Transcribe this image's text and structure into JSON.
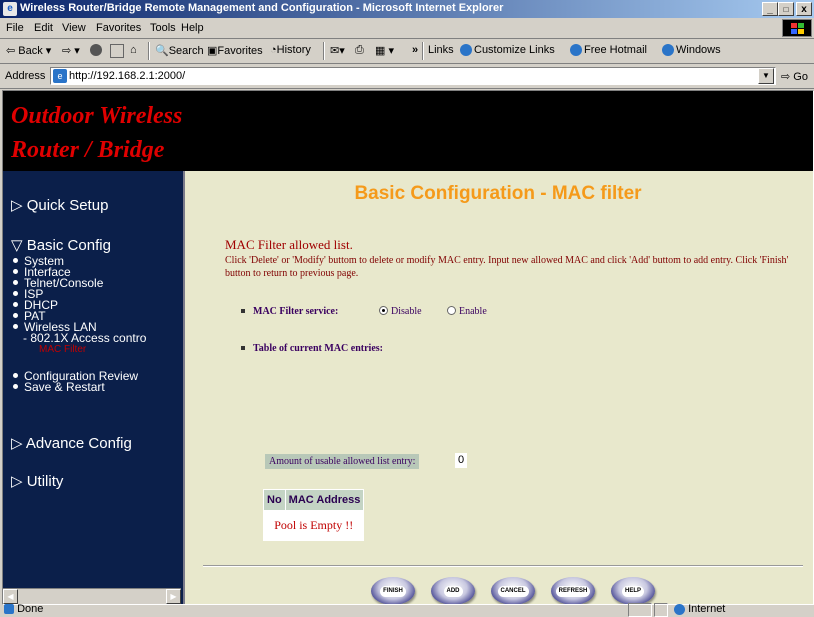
{
  "window": {
    "title": "Wireless Router/Bridge Remote Management and Configuration - Microsoft Internet Explorer",
    "buttons": [
      "_",
      "□",
      "x"
    ]
  },
  "menu": [
    "File",
    "Edit",
    "View",
    "Favorites",
    "Tools",
    "Help"
  ],
  "toolbar": {
    "back": "Back",
    "search": "Search",
    "favorites": "Favorites",
    "history": "History",
    "chevron": "»",
    "links": "Links",
    "link_items": [
      "Customize Links",
      "Free Hotmail",
      "Windows"
    ]
  },
  "address": {
    "label": "Address",
    "url": "http://192.168.2.1:2000/",
    "go": "Go"
  },
  "banner": {
    "line1": "Outdoor Wireless",
    "line2": "Router / Bridge"
  },
  "sidebar": {
    "quick_setup": "Quick Setup",
    "basic_config": "Basic Config",
    "basic_items": [
      "System",
      "Interface",
      "Telnet/Console",
      "ISP",
      "DHCP",
      "PAT",
      "Wireless LAN"
    ],
    "sub_item": "- 802.1X Access contro",
    "sub_item_active": "MAC Filter",
    "review_items": [
      "Configuration Review",
      "Save & Restart"
    ],
    "advance_config": "Advance Config",
    "utility": "Utility"
  },
  "main": {
    "page_title": "Basic Configuration - MAC filter",
    "section_title": "MAC Filter allowed list.",
    "description": "Click 'Delete' or 'Modify' buttom to delete or modify MAC entry. Input new allowed MAC and click 'Add' buttom to add entry. Click 'Finish' button to return to previous page.",
    "service_label": "MAC Filter service:",
    "radio_disable": "Disable",
    "radio_enable": "Enable",
    "service_value": "Disable",
    "table_label": "Table of current MAC entries:",
    "amount_label": "Amount of usable allowed list entry:",
    "amount_value": "0",
    "table_headers": [
      "No",
      "MAC Address"
    ],
    "table_empty": "Pool is Empty !!",
    "buttons": [
      "FINISH",
      "ADD",
      "CANCEL",
      "REFRESH",
      "HELP"
    ]
  },
  "statusbar": {
    "status": "Done",
    "zone": "Internet"
  },
  "colors": {
    "title_orange": "#f59a1a",
    "banner_red": "#e00000",
    "sidebar_navy": "#0b1f4a",
    "content_bg": "#e8e8cc"
  }
}
